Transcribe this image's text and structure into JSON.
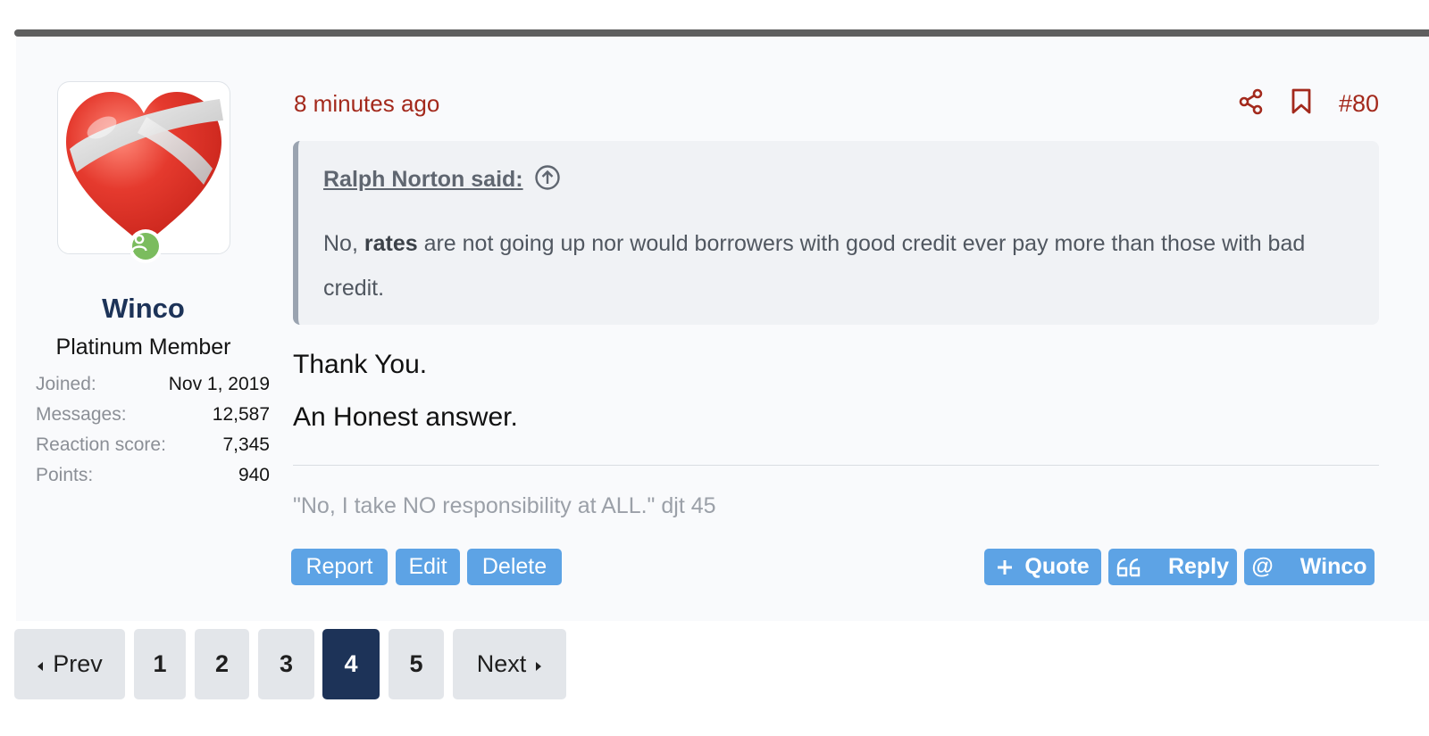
{
  "user": {
    "name": "Winco",
    "title": "Platinum Member",
    "avatar_icon": "mending-heart-icon",
    "online_status": "online",
    "stats": [
      {
        "label": "Joined:",
        "value": "Nov 1, 2019"
      },
      {
        "label": "Messages:",
        "value": "12,587"
      },
      {
        "label": "Reaction score:",
        "value": "7,345"
      },
      {
        "label": "Points:",
        "value": "940"
      }
    ]
  },
  "post": {
    "timestamp": "8 minutes ago",
    "number": "#80",
    "quote": {
      "author": "Ralph Norton said:",
      "body_prefix": "No, ",
      "body_bold": "rates",
      "body_rest": " are not going up nor would borrowers with good credit ever pay more than those with bad credit."
    },
    "lines": [
      "Thank You.",
      "An Honest answer."
    ],
    "signature": "\"No, I take NO responsibility at ALL.\" djt 45"
  },
  "buttons": {
    "report": "Report",
    "edit": "Edit",
    "delete": "Delete",
    "quote": "Quote",
    "reply": "Reply",
    "mention": "Winco"
  },
  "pagination": {
    "prev": "Prev",
    "next": "Next",
    "pages": [
      "1",
      "2",
      "3",
      "4",
      "5"
    ],
    "current": "4"
  },
  "colors": {
    "accent_red": "#a3291c",
    "username_navy": "#1d3358",
    "button_blue": "#5da3e5",
    "online_green": "#7bbc5e"
  }
}
